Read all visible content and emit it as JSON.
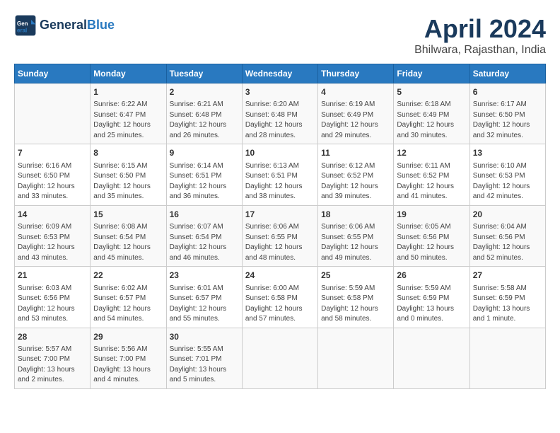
{
  "header": {
    "logo_line1": "General",
    "logo_line2": "Blue",
    "title": "April 2024",
    "subtitle": "Bhilwara, Rajasthan, India"
  },
  "weekdays": [
    "Sunday",
    "Monday",
    "Tuesday",
    "Wednesday",
    "Thursday",
    "Friday",
    "Saturday"
  ],
  "weeks": [
    [
      {
        "day": "",
        "info": ""
      },
      {
        "day": "1",
        "info": "Sunrise: 6:22 AM\nSunset: 6:47 PM\nDaylight: 12 hours\nand 25 minutes."
      },
      {
        "day": "2",
        "info": "Sunrise: 6:21 AM\nSunset: 6:48 PM\nDaylight: 12 hours\nand 26 minutes."
      },
      {
        "day": "3",
        "info": "Sunrise: 6:20 AM\nSunset: 6:48 PM\nDaylight: 12 hours\nand 28 minutes."
      },
      {
        "day": "4",
        "info": "Sunrise: 6:19 AM\nSunset: 6:49 PM\nDaylight: 12 hours\nand 29 minutes."
      },
      {
        "day": "5",
        "info": "Sunrise: 6:18 AM\nSunset: 6:49 PM\nDaylight: 12 hours\nand 30 minutes."
      },
      {
        "day": "6",
        "info": "Sunrise: 6:17 AM\nSunset: 6:50 PM\nDaylight: 12 hours\nand 32 minutes."
      }
    ],
    [
      {
        "day": "7",
        "info": "Sunrise: 6:16 AM\nSunset: 6:50 PM\nDaylight: 12 hours\nand 33 minutes."
      },
      {
        "day": "8",
        "info": "Sunrise: 6:15 AM\nSunset: 6:50 PM\nDaylight: 12 hours\nand 35 minutes."
      },
      {
        "day": "9",
        "info": "Sunrise: 6:14 AM\nSunset: 6:51 PM\nDaylight: 12 hours\nand 36 minutes."
      },
      {
        "day": "10",
        "info": "Sunrise: 6:13 AM\nSunset: 6:51 PM\nDaylight: 12 hours\nand 38 minutes."
      },
      {
        "day": "11",
        "info": "Sunrise: 6:12 AM\nSunset: 6:52 PM\nDaylight: 12 hours\nand 39 minutes."
      },
      {
        "day": "12",
        "info": "Sunrise: 6:11 AM\nSunset: 6:52 PM\nDaylight: 12 hours\nand 41 minutes."
      },
      {
        "day": "13",
        "info": "Sunrise: 6:10 AM\nSunset: 6:53 PM\nDaylight: 12 hours\nand 42 minutes."
      }
    ],
    [
      {
        "day": "14",
        "info": "Sunrise: 6:09 AM\nSunset: 6:53 PM\nDaylight: 12 hours\nand 43 minutes."
      },
      {
        "day": "15",
        "info": "Sunrise: 6:08 AM\nSunset: 6:54 PM\nDaylight: 12 hours\nand 45 minutes."
      },
      {
        "day": "16",
        "info": "Sunrise: 6:07 AM\nSunset: 6:54 PM\nDaylight: 12 hours\nand 46 minutes."
      },
      {
        "day": "17",
        "info": "Sunrise: 6:06 AM\nSunset: 6:55 PM\nDaylight: 12 hours\nand 48 minutes."
      },
      {
        "day": "18",
        "info": "Sunrise: 6:06 AM\nSunset: 6:55 PM\nDaylight: 12 hours\nand 49 minutes."
      },
      {
        "day": "19",
        "info": "Sunrise: 6:05 AM\nSunset: 6:56 PM\nDaylight: 12 hours\nand 50 minutes."
      },
      {
        "day": "20",
        "info": "Sunrise: 6:04 AM\nSunset: 6:56 PM\nDaylight: 12 hours\nand 52 minutes."
      }
    ],
    [
      {
        "day": "21",
        "info": "Sunrise: 6:03 AM\nSunset: 6:56 PM\nDaylight: 12 hours\nand 53 minutes."
      },
      {
        "day": "22",
        "info": "Sunrise: 6:02 AM\nSunset: 6:57 PM\nDaylight: 12 hours\nand 54 minutes."
      },
      {
        "day": "23",
        "info": "Sunrise: 6:01 AM\nSunset: 6:57 PM\nDaylight: 12 hours\nand 55 minutes."
      },
      {
        "day": "24",
        "info": "Sunrise: 6:00 AM\nSunset: 6:58 PM\nDaylight: 12 hours\nand 57 minutes."
      },
      {
        "day": "25",
        "info": "Sunrise: 5:59 AM\nSunset: 6:58 PM\nDaylight: 12 hours\nand 58 minutes."
      },
      {
        "day": "26",
        "info": "Sunrise: 5:59 AM\nSunset: 6:59 PM\nDaylight: 13 hours\nand 0 minutes."
      },
      {
        "day": "27",
        "info": "Sunrise: 5:58 AM\nSunset: 6:59 PM\nDaylight: 13 hours\nand 1 minute."
      }
    ],
    [
      {
        "day": "28",
        "info": "Sunrise: 5:57 AM\nSunset: 7:00 PM\nDaylight: 13 hours\nand 2 minutes."
      },
      {
        "day": "29",
        "info": "Sunrise: 5:56 AM\nSunset: 7:00 PM\nDaylight: 13 hours\nand 4 minutes."
      },
      {
        "day": "30",
        "info": "Sunrise: 5:55 AM\nSunset: 7:01 PM\nDaylight: 13 hours\nand 5 minutes."
      },
      {
        "day": "",
        "info": ""
      },
      {
        "day": "",
        "info": ""
      },
      {
        "day": "",
        "info": ""
      },
      {
        "day": "",
        "info": ""
      }
    ]
  ]
}
